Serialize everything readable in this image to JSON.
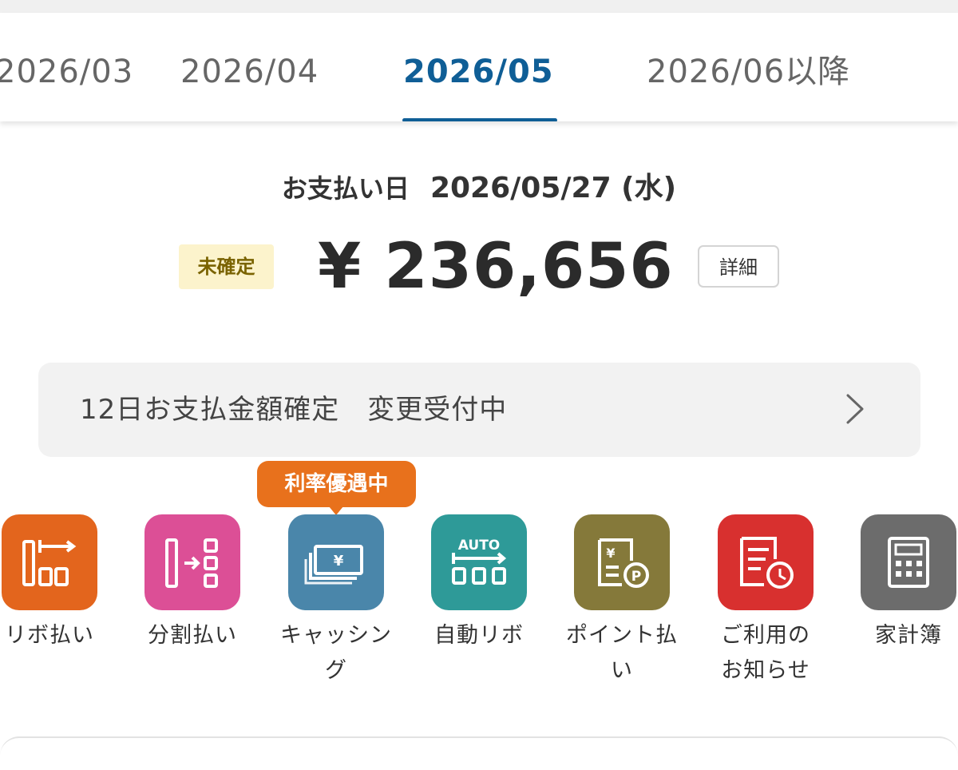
{
  "tabs": [
    {
      "label": "2026/03"
    },
    {
      "label": "2026/04"
    },
    {
      "label": "2026/05",
      "active": true
    },
    {
      "label": "2026/06以降"
    }
  ],
  "payment": {
    "date_label": "お支払い日",
    "date_value": "2026/05/27 (水)",
    "status_badge": "未確定",
    "amount": "¥ 236,656",
    "detail_button": "詳細"
  },
  "notice": {
    "text": "12日お支払金額確定　変更受付中",
    "icon": "chevron-right-icon"
  },
  "promo_tooltip": "利率優遇中",
  "menu": [
    {
      "label": "リボ払い",
      "icon": "revolving-payment-icon",
      "color": "#e3651d"
    },
    {
      "label": "分割払い",
      "icon": "installment-payment-icon",
      "color": "#dc4f96"
    },
    {
      "label": "キャッシング",
      "icon": "cashing-icon",
      "color": "#4a86aa"
    },
    {
      "label": "自動リボ",
      "icon": "auto-revolving-icon",
      "color": "#2e9a98"
    },
    {
      "label": "ポイント払い",
      "icon": "point-payment-icon",
      "color": "#85793a"
    },
    {
      "label": "ご利用の\nお知らせ",
      "icon": "usage-notification-icon",
      "color": "#d8302f"
    },
    {
      "label": "家計簿",
      "icon": "household-ledger-icon",
      "color": "#6c6c6c"
    }
  ],
  "menu_auto_text": "AUTO",
  "colors": {
    "accent": "#0f5e96",
    "promo": "#e8711c",
    "badge_bg": "#fcf3cc",
    "badge_text": "#7a6300"
  }
}
